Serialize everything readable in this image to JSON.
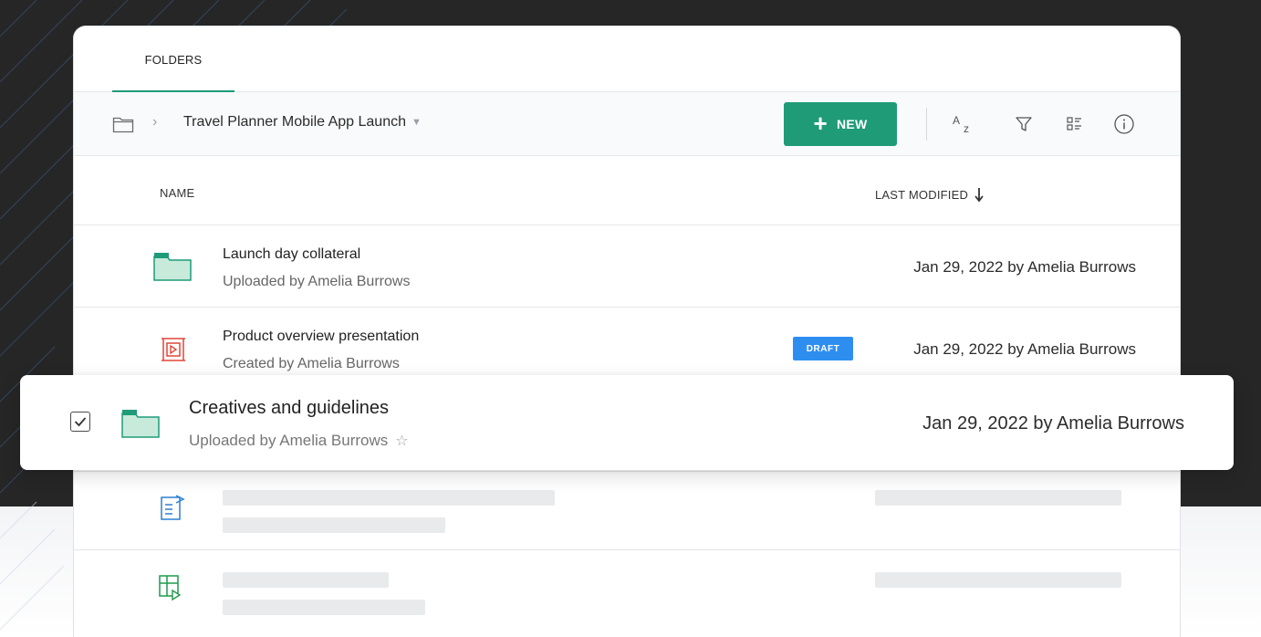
{
  "tabs": [
    {
      "label": "FOLDERS"
    }
  ],
  "breadcrumb": {
    "current": "Travel Planner Mobile App Launch"
  },
  "toolbar": {
    "new_label": "NEW"
  },
  "columns": {
    "name": "NAME",
    "last_modified": "LAST MODIFIED"
  },
  "rows": [
    {
      "title": "Launch day collateral",
      "subtitle": "Uploaded by Amelia Burrows",
      "modified": "Jan 29, 2022 by Amelia Burrows",
      "icon": "folder-icon"
    },
    {
      "title": "Product overview presentation",
      "subtitle": "Created by Amelia Burrows",
      "modified": "Jan 29, 2022 by Amelia Burrows",
      "badge": "DRAFT",
      "icon": "presentation-icon"
    }
  ],
  "selected_row": {
    "title": "Creatives and guidelines",
    "subtitle": "Uploaded by Amelia Burrows",
    "modified": "Jan 29, 2022 by Amelia Burrows",
    "checked": true,
    "icon": "folder-icon"
  },
  "placeholder_rows": [
    {
      "icon": "document-icon"
    },
    {
      "icon": "spreadsheet-icon"
    }
  ],
  "colors": {
    "accent": "#1f9b78",
    "draft": "#2d8ef0",
    "backdrop": "#262626"
  }
}
